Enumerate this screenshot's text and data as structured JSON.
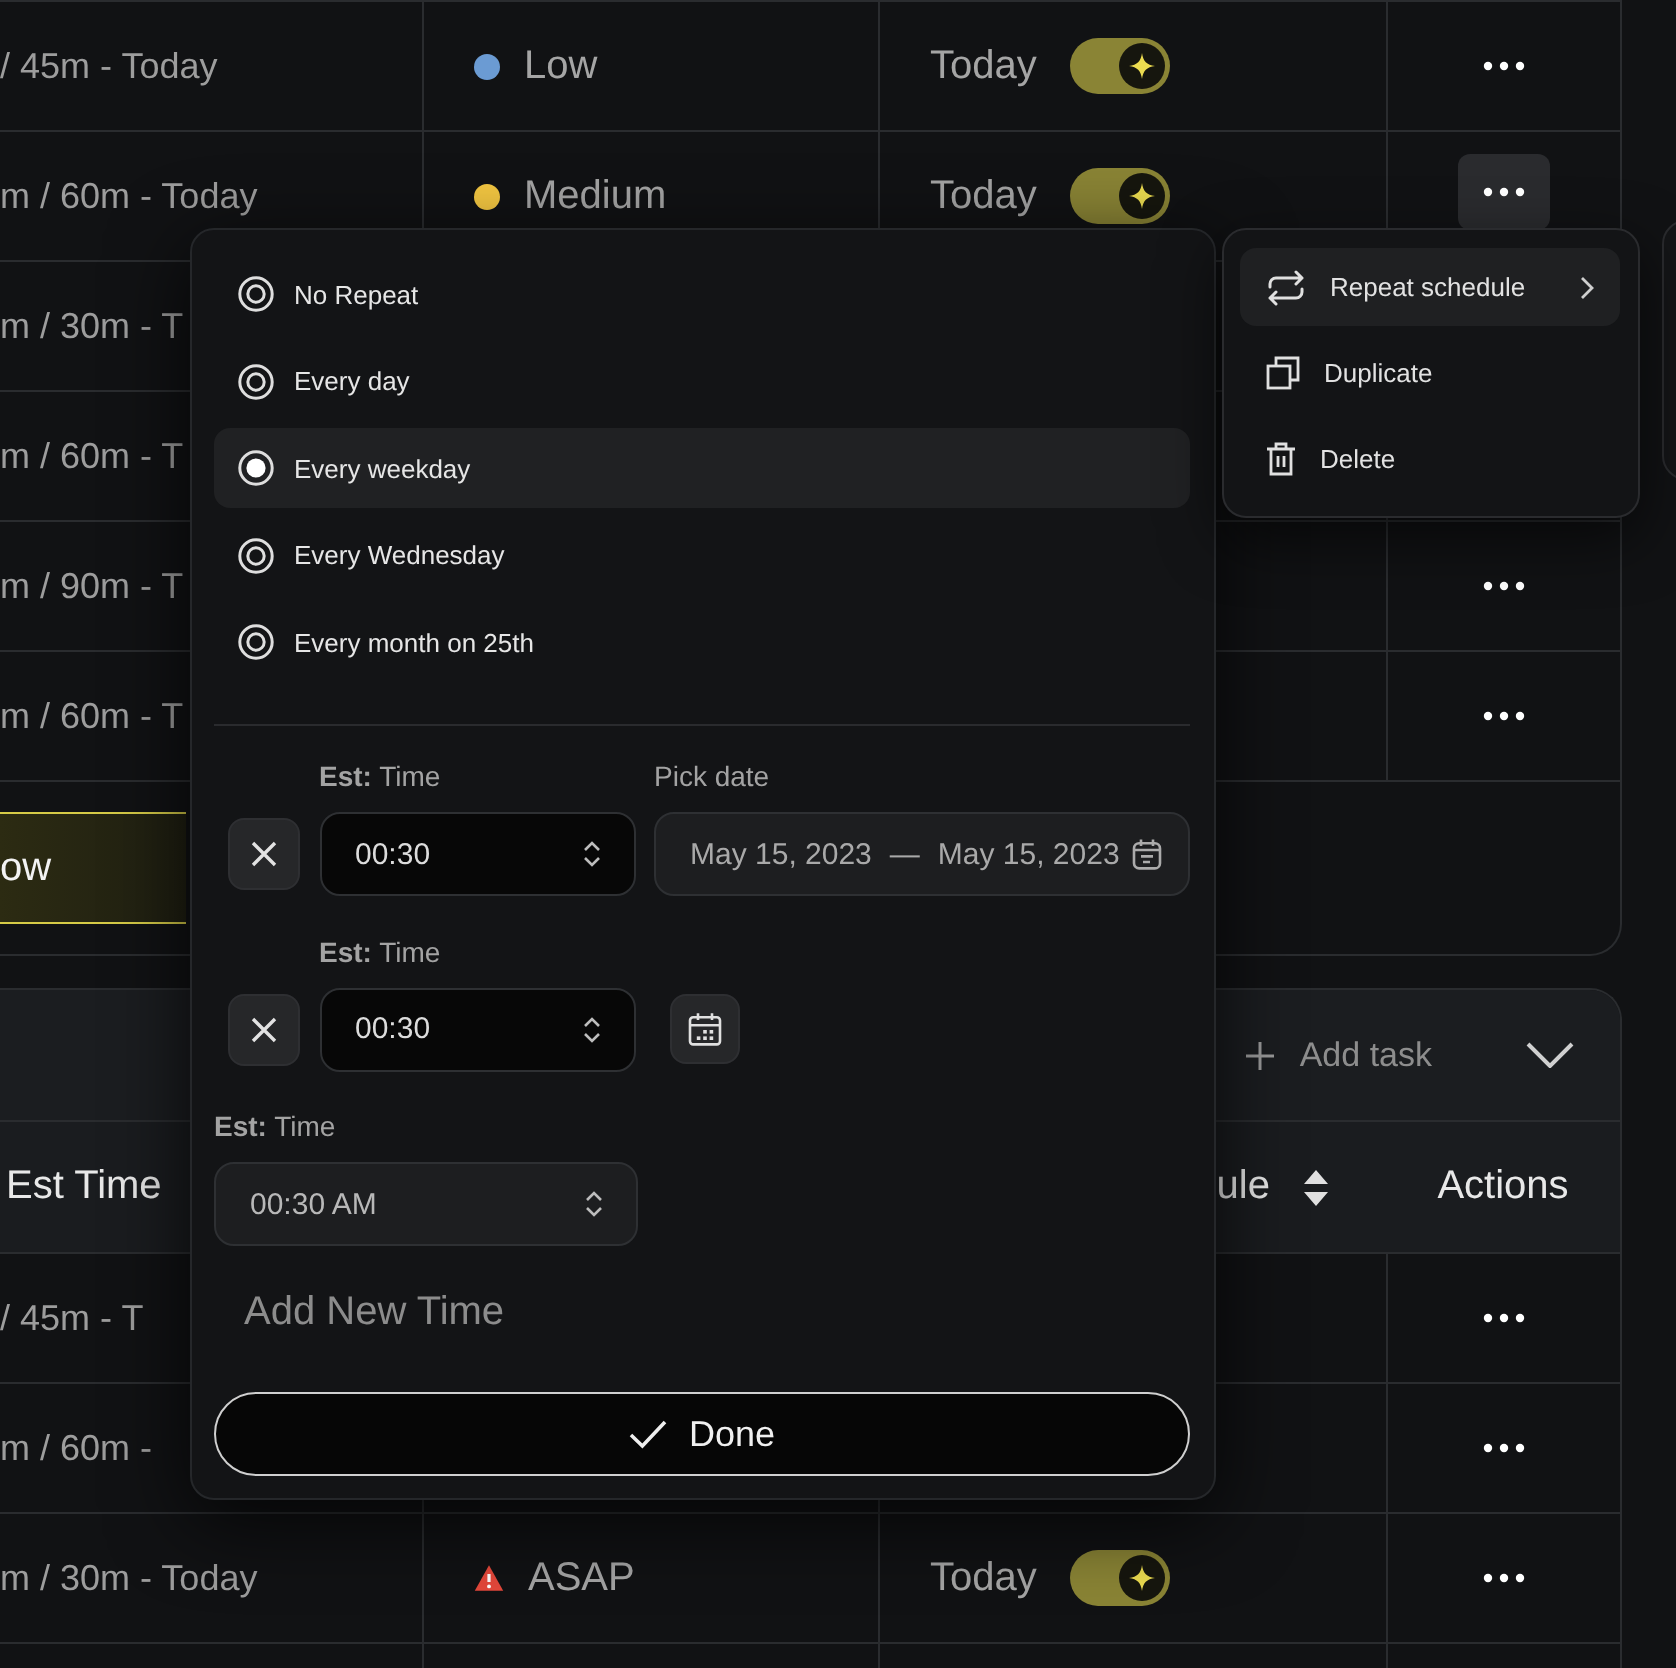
{
  "top_table": {
    "rows": [
      {
        "est_time": "/ 45m - Today",
        "priority": {
          "kind": "dot",
          "label": "Low",
          "color": "#6b9bd3"
        },
        "schedule": {
          "label": "Today",
          "on": true
        },
        "actions": {
          "open": false
        }
      },
      {
        "est_time": "m / 60m - Today",
        "priority": {
          "kind": "dot",
          "label": "Medium",
          "color": "#f5c842"
        },
        "schedule": {
          "label": "Today",
          "on": true
        },
        "actions": {
          "open": true
        }
      },
      {
        "est_time": "m / 30m - T"
      },
      {
        "est_time": "m / 60m - T"
      },
      {
        "est_time": "m / 90m - T",
        "actions": {
          "open": false
        }
      },
      {
        "est_time": "m / 60m - T",
        "actions": {
          "open": false
        }
      }
    ],
    "footer_button": "ow"
  },
  "bottom_table": {
    "add_task": "Add task",
    "columns": [
      {
        "label": "Est Time",
        "sortable": false
      },
      {
        "label": "ule",
        "sortable": true
      },
      {
        "label": "Actions",
        "sortable": false
      }
    ],
    "rows": [
      {
        "est_time": "/ 45m - T",
        "actions": {
          "open": false
        }
      },
      {
        "est_time": "m / 60m -",
        "actions": {
          "open": false
        }
      },
      {
        "est_time": "m / 30m - Today",
        "priority": {
          "kind": "warning",
          "label": "ASAP",
          "color": "#e5483b"
        },
        "schedule": {
          "label": "Today",
          "on": true
        },
        "actions": {
          "open": false
        }
      }
    ]
  },
  "repeat_popup": {
    "options": [
      {
        "label": "No Repeat",
        "selected": false
      },
      {
        "label": "Every day",
        "selected": false
      },
      {
        "label": "Every weekday",
        "selected": true
      },
      {
        "label": "Every Wednesday",
        "selected": false
      },
      {
        "label": "Every month on 25th",
        "selected": false
      }
    ],
    "time_rows": [
      {
        "kind": "range",
        "label": "**Est:** Time",
        "value": "00:30",
        "date_label": "Pick date",
        "date_start": "May 15, 2023",
        "date_separator": "—",
        "date_end": "May 15, 2023"
      },
      {
        "kind": "calendar",
        "label": "**Est:** Time",
        "value": "00:30"
      },
      {
        "kind": "plain",
        "label": "**Est:** Time",
        "value": "00:30 AM"
      }
    ],
    "add_time": "Add New Time",
    "done": "Done"
  },
  "context_menu": {
    "items": [
      {
        "kind": "repeat",
        "label": "Repeat schedule",
        "selected": true,
        "submenu": true
      },
      {
        "kind": "duplicate",
        "label": "Duplicate",
        "selected": false,
        "submenu": false
      },
      {
        "kind": "delete",
        "label": "Delete",
        "selected": false,
        "submenu": false
      }
    ]
  }
}
